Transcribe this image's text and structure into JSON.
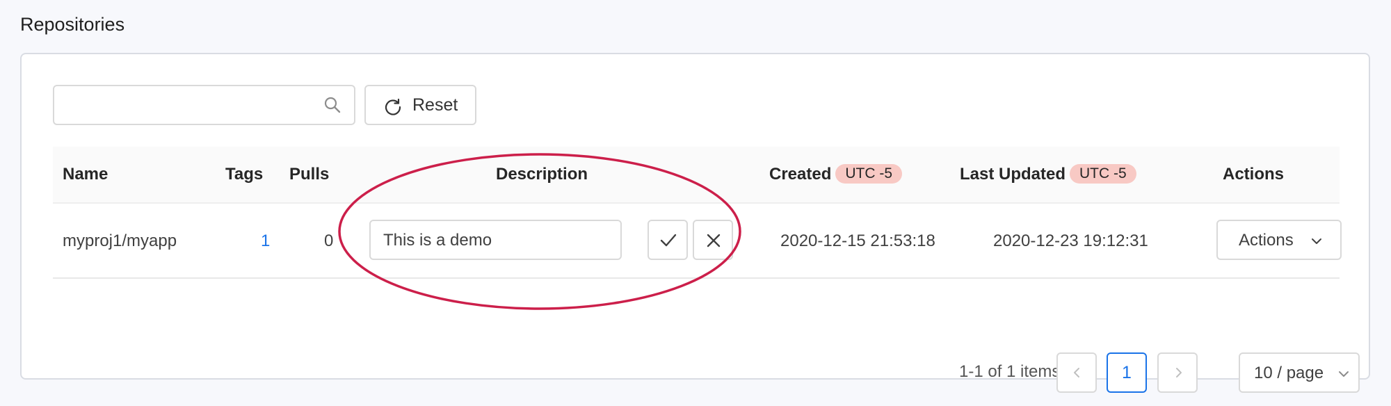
{
  "page": {
    "title": "Repositories"
  },
  "toolbar": {
    "search_value": "",
    "search_icon": "search-icon",
    "reset_label": "Reset",
    "reset_icon": "reload-icon"
  },
  "table": {
    "columns": {
      "name": "Name",
      "tags": "Tags",
      "pulls": "Pulls",
      "description": "Description",
      "created": "Created",
      "created_tz": "UTC -5",
      "last_updated": "Last Updated",
      "last_updated_tz": "UTC -5",
      "actions": "Actions"
    },
    "rows": [
      {
        "name": "myproj1/myapp",
        "tags": "1",
        "pulls": "0",
        "description": "This is a demo",
        "created": "2020-12-15 21:53:18",
        "last_updated": "2020-12-23 19:12:31",
        "actions_label": "Actions"
      }
    ]
  },
  "pagination": {
    "summary": "1-1 of 1 items",
    "current_page": "1",
    "page_size": "10 / page"
  },
  "colors": {
    "accent": "#1a73e8",
    "tz_badge": "#f8c9c4",
    "highlight": "#cc1f4a"
  }
}
